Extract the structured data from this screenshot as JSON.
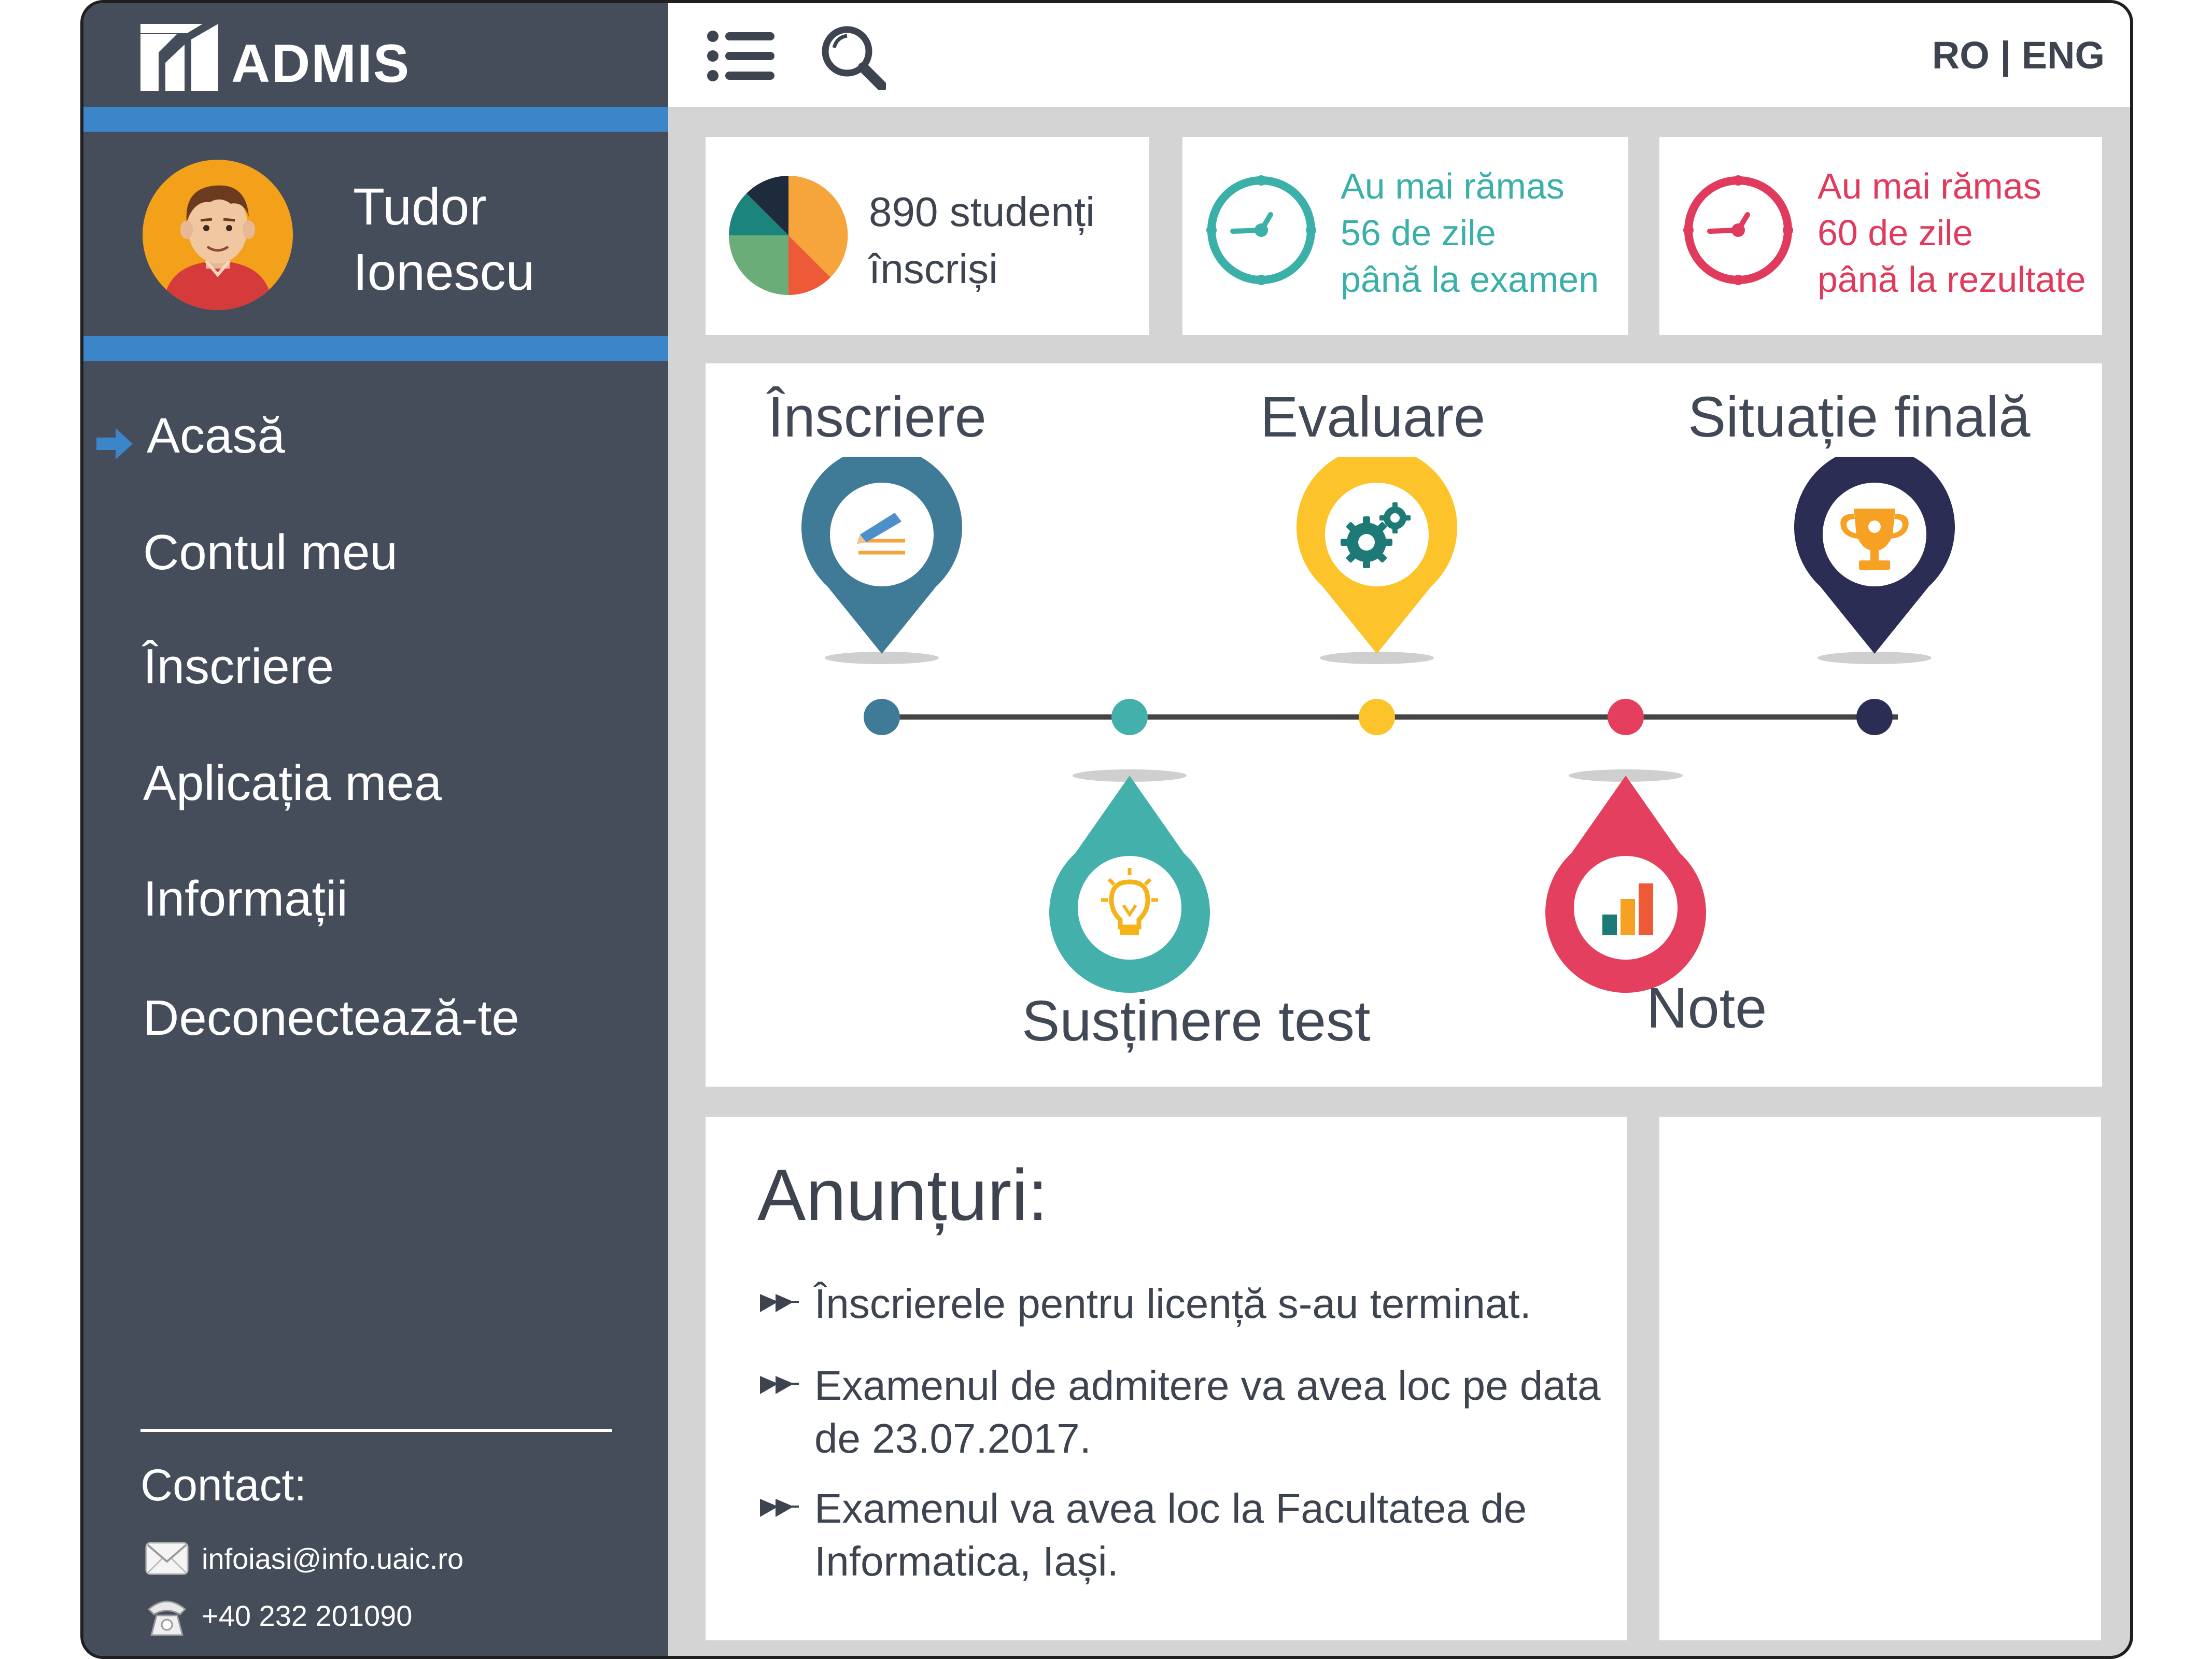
{
  "app": {
    "logo_text": "ADMIS"
  },
  "user": {
    "first_name": "Tudor",
    "last_name": "Ionescu"
  },
  "nav": {
    "items": [
      {
        "label": "Acasă",
        "active": true
      },
      {
        "label": "Contul meu"
      },
      {
        "label": "Înscriere"
      },
      {
        "label": "Aplicația mea"
      },
      {
        "label": "Informații"
      },
      {
        "label": "Deconectează-te"
      }
    ]
  },
  "contact": {
    "title": "Contact:",
    "email": "infoiasi@info.uaic.ro",
    "phone": "+40 232 201090"
  },
  "topbar": {
    "lang_ro": "RO",
    "lang_sep": " | ",
    "lang_en": "ENG"
  },
  "stats": {
    "students": {
      "line1": "890 studenți",
      "line2": "înscriși"
    },
    "exam": {
      "line1": "Au mai rămas",
      "line2": "56 de zile",
      "line3": "până la examen",
      "color": "#3ab0a8"
    },
    "results": {
      "line1": "Au mai rămas",
      "line2": "60 de zile",
      "line3": "până la rezultate",
      "color": "#e03a5c"
    }
  },
  "timeline": {
    "steps": [
      {
        "label": "Înscriere",
        "color": "#3f7b97",
        "icon": "pencil-icon"
      },
      {
        "label": "Susținere test",
        "color": "#44b0ab",
        "icon": "lightbulb-icon"
      },
      {
        "label": "Evaluare",
        "color": "#fcc32b",
        "icon": "gears-icon"
      },
      {
        "label": "Note",
        "color": "#e43f5e",
        "icon": "bar-chart-icon"
      },
      {
        "label": "Situație finală",
        "color": "#2c2d54",
        "icon": "trophy-icon"
      }
    ],
    "line_color": "#444444"
  },
  "announcements": {
    "title": "Anunțuri:",
    "items": [
      "Înscrierele pentru licență s-au terminat.",
      "Examenul de admitere va avea loc pe data de 23.07.2017.",
      "Examenul va avea loc la Facultatea de Informatica, Iași."
    ]
  },
  "colors": {
    "sidebar": "#464d5a",
    "accent_blue": "#3b86c9",
    "background": "#d4d4d4"
  }
}
